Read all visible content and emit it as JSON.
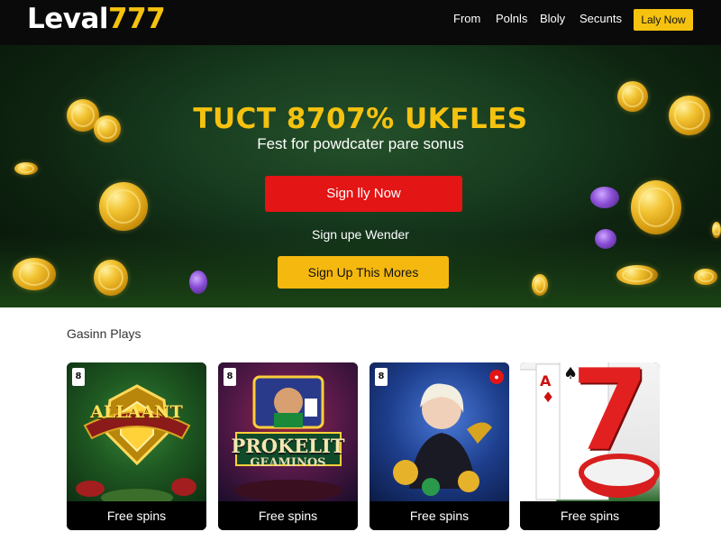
{
  "header": {
    "logo_part1": "Leval",
    "logo_part2": "777",
    "nav": [
      "From",
      "Polnls",
      "Bloly",
      "Secunts"
    ],
    "cta": "Laly Now"
  },
  "hero": {
    "title": "TUCT 8707% UKFLES",
    "subtitle": "Fest for powdcater pare sonus",
    "primary_button": "Sign lly Now",
    "middle_text": "Sign upe Wender",
    "secondary_button": "Sign Up This Mores"
  },
  "games": {
    "section_title": "Gasinn Plays",
    "cards": [
      {
        "label": "Free spins",
        "card_rank": "8",
        "art_text": "ALLAANT"
      },
      {
        "label": "Free spins",
        "card_rank": "8",
        "art_text": "PROKELIT",
        "art_text2": "GEAMINOS"
      },
      {
        "label": "Free spins",
        "card_rank": "8"
      },
      {
        "label": "Free spins",
        "art_text": "7"
      }
    ]
  },
  "colors": {
    "accent_yellow": "#f5c20f",
    "cta_red": "#e31515",
    "hero_green": "#163a1e"
  }
}
